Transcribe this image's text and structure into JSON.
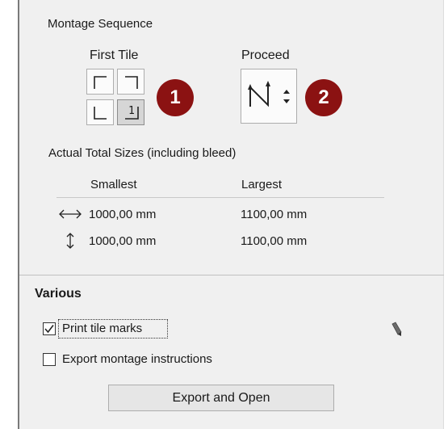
{
  "montage": {
    "title": "Montage Sequence",
    "first_tile_label": "First Tile",
    "proceed_label": "Proceed",
    "selected_tile": "bottom-right",
    "selected_tile_glyph": "1",
    "proceed_icon": "zigzag-n-icon",
    "callouts": [
      "1",
      "2"
    ],
    "callout_color": "#8b1212"
  },
  "sizes": {
    "title": "Actual Total Sizes (including bleed)",
    "col_smallest": "Smallest",
    "col_largest": "Largest",
    "rows": [
      {
        "icon": "horizontal-arrow-icon",
        "smallest": "1000,00 mm",
        "largest": "1100,00 mm"
      },
      {
        "icon": "vertical-arrow-icon",
        "smallest": "1000,00 mm",
        "largest": "1100,00 mm"
      }
    ]
  },
  "various": {
    "title": "Various",
    "print_tile_marks_label": "Print tile marks",
    "print_tile_marks_checked": true,
    "export_instructions_label": "Export montage instructions",
    "export_instructions_checked": false,
    "export_button_label": "Export and Open"
  }
}
